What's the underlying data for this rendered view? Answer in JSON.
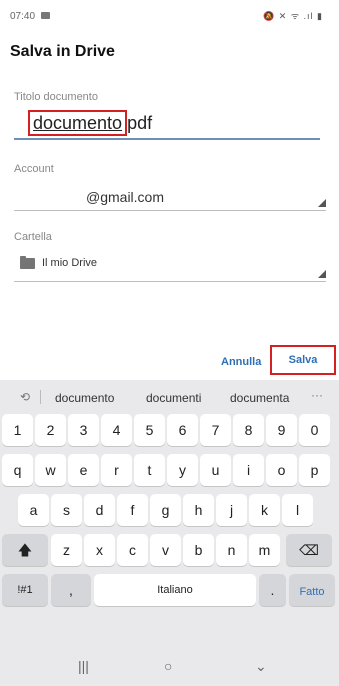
{
  "status": {
    "time": "07:40",
    "icons_text": "🔕 ✕ ᯤ .ıl ▮"
  },
  "dialog": {
    "title": "Salva in Drive"
  },
  "fields": {
    "title_label": "Titolo documento",
    "title_selected": "documento",
    "title_rest": "pdf",
    "account_label": "Account",
    "account_value": "@gmail.com",
    "folder_label": "Cartella",
    "folder_value": "Il mio Drive"
  },
  "buttons": {
    "cancel": "Annulla",
    "save": "Salva"
  },
  "keyboard": {
    "suggestion_icon": "⟲",
    "suggestions": [
      "documento",
      "documenti",
      "documenta"
    ],
    "more": "···",
    "row_numbers": [
      "1",
      "2",
      "3",
      "4",
      "5",
      "6",
      "7",
      "8",
      "9",
      "0"
    ],
    "row1": [
      "q",
      "w",
      "e",
      "r",
      "t",
      "y",
      "u",
      "i",
      "o",
      "p"
    ],
    "row2": [
      "a",
      "s",
      "d",
      "f",
      "g",
      "h",
      "j",
      "k",
      "l"
    ],
    "row3": [
      "z",
      "x",
      "c",
      "v",
      "b",
      "n",
      "m"
    ],
    "shift": "🡅",
    "backspace": "⌫",
    "symbols": "!#1",
    "comma": ",",
    "space": "Italiano",
    "period": ".",
    "done": "Fatto"
  },
  "nav": {
    "recents": "|||",
    "home": "○",
    "back": "⌄"
  }
}
